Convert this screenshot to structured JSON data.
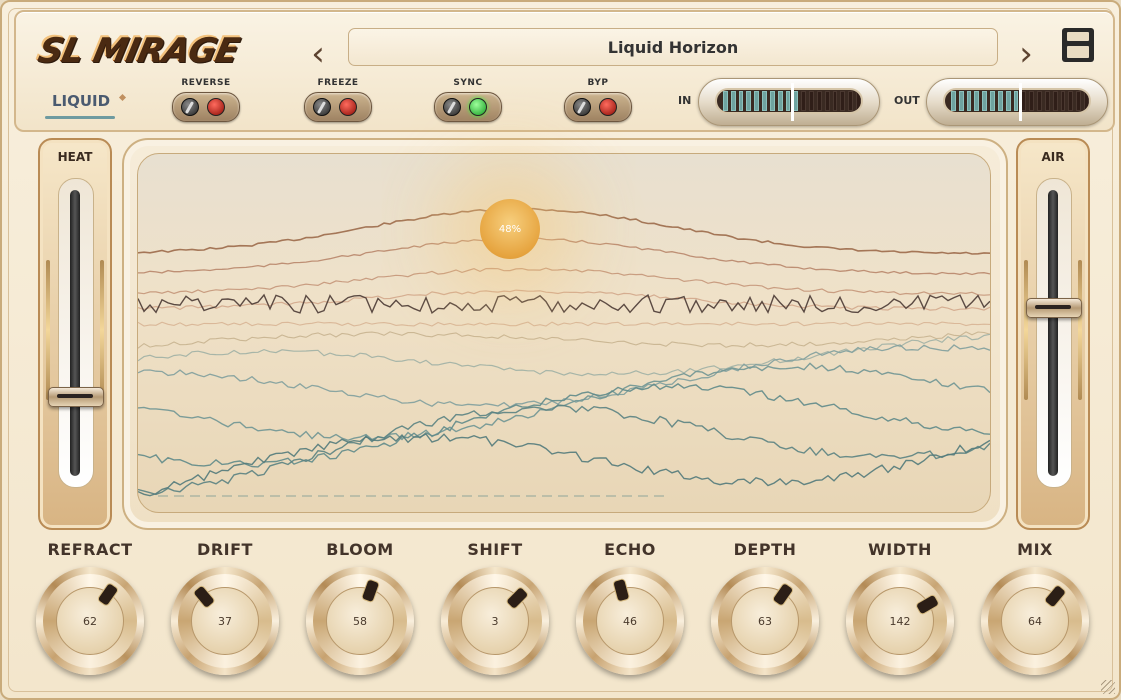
{
  "app": {
    "logo_text": "SL MIRAGE",
    "preset_name": "Liquid Horizon",
    "prev_symbol": "‹",
    "next_symbol": "›"
  },
  "mode_tab": {
    "label": "LIQUID"
  },
  "switches": [
    {
      "label": "REVERSE",
      "led": "red"
    },
    {
      "label": "FREEZE",
      "led": "red"
    },
    {
      "label": "SYNC",
      "led": "green"
    },
    {
      "label": "BYP",
      "led": "red"
    }
  ],
  "meters": {
    "in_label": "IN",
    "out_label": "OUT",
    "in_level_segments": 10,
    "out_level_segments": 9
  },
  "sliders": {
    "heat": {
      "label": "HEAT",
      "value": 0.27
    },
    "air": {
      "label": "AIR",
      "value": 0.6
    }
  },
  "display": {
    "sun_value": "48%"
  },
  "knobs": [
    {
      "label": "REFRACT",
      "value": "62",
      "angle": 35
    },
    {
      "label": "DRIFT",
      "value": "37",
      "angle": -40
    },
    {
      "label": "BLOOM",
      "value": "58",
      "angle": 20
    },
    {
      "label": "SHIFT",
      "value": "3",
      "angle": 45
    },
    {
      "label": "ECHO",
      "value": "46",
      "angle": -15
    },
    {
      "label": "DEPTH",
      "value": "63",
      "angle": 35
    },
    {
      "label": "WIDTH",
      "value": "142",
      "angle": 60
    },
    {
      "label": "MIX",
      "value": "64",
      "angle": 40
    }
  ],
  "colors": {
    "accent_teal": "#6fa3a0",
    "gold": "#c9a574",
    "led_red": "#c4140a",
    "led_green": "#2ad33a"
  }
}
